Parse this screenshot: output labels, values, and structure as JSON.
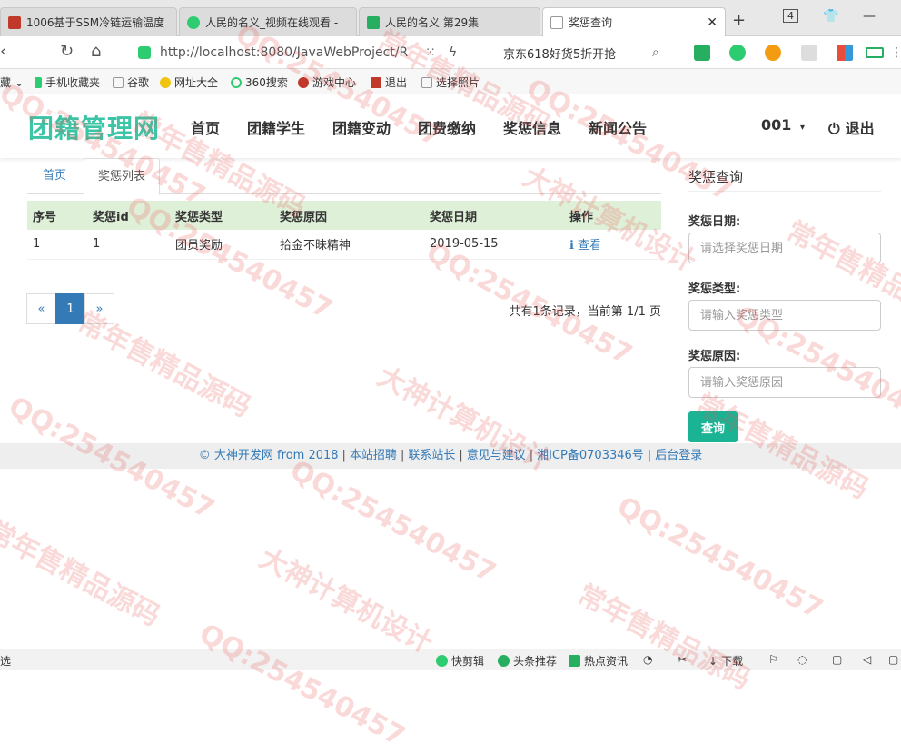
{
  "browser": {
    "tabs": [
      {
        "label": "1006基于SSM冷链运输温度",
        "active": false
      },
      {
        "label": "人民的名义_视频在线观看 -",
        "active": false
      },
      {
        "label": "人民的名义 第29集",
        "active": false
      },
      {
        "label": "奖惩查询",
        "active": true
      }
    ],
    "tab_count": "4",
    "url": "http://localhost:8080/JavaWebProject/R",
    "search_suggestion": "京东618好货5折开抢",
    "bookmarks": [
      {
        "label": "藏"
      },
      {
        "label": "手机收藏夹"
      },
      {
        "label": "谷歌"
      },
      {
        "label": "网址大全"
      },
      {
        "label": "360搜索"
      },
      {
        "label": "游戏中心"
      },
      {
        "label": "退出"
      },
      {
        "label": "选择照片"
      }
    ],
    "status_items": [
      {
        "label": "快剪辑"
      },
      {
        "label": "头条推荐"
      },
      {
        "label": "热点资讯"
      },
      {
        "label": "下载"
      }
    ],
    "status_left": "选"
  },
  "site": {
    "brand": "团籍管理网",
    "nav": [
      {
        "label": "首页"
      },
      {
        "label": "团籍学生"
      },
      {
        "label": "团籍变动"
      },
      {
        "label": "团费缴纳"
      },
      {
        "label": "奖惩信息"
      },
      {
        "label": "新闻公告"
      }
    ],
    "user": "001",
    "logout": "退出"
  },
  "page_tabs": [
    {
      "label": "首页",
      "active": false
    },
    {
      "label": "奖惩列表",
      "active": true
    }
  ],
  "table": {
    "headers": [
      "序号",
      "奖惩id",
      "奖惩类型",
      "奖惩原因",
      "奖惩日期",
      "操作"
    ],
    "rows": [
      {
        "no": "1",
        "id": "1",
        "type": "团员奖励",
        "reason": "拾金不昧精神",
        "date": "2019-05-15",
        "action": "查看"
      }
    ]
  },
  "pager": {
    "prev": "«",
    "current": "1",
    "next": "»",
    "info": "共有1条记录，当前第 1/1 页"
  },
  "sidebar": {
    "title": "奖惩查询",
    "date_label": "奖惩日期:",
    "date_placeholder": "请选择奖惩日期",
    "type_label": "奖惩类型:",
    "type_placeholder": "请输入奖惩类型",
    "reason_label": "奖惩原因:",
    "reason_placeholder": "请输入奖惩原因",
    "search_button": "查询"
  },
  "footer": {
    "copyright": "© 大神开发网 from 2018",
    "links": [
      "本站招聘",
      "联系站长",
      "意见与建议",
      "湘ICP备0703346号",
      "后台登录"
    ]
  },
  "watermark": {
    "qq": "QQ:254540457",
    "slogan1": "大神计算机设计",
    "slogan2": "常年售精品源码"
  },
  "colors": {
    "brand": "#3cc4a6",
    "link": "#337ab7",
    "table_header": "#dff0d8",
    "search_button": "#1ab394"
  }
}
